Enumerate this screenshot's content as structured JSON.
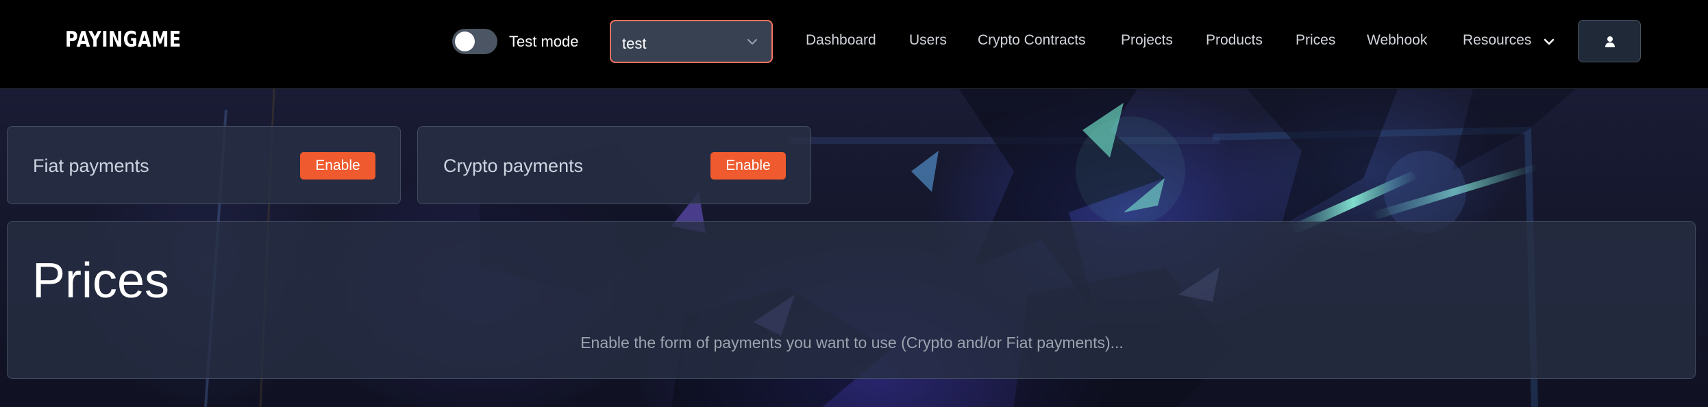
{
  "brand": {
    "logo_text": "PAYINGAME"
  },
  "header": {
    "test_mode": {
      "label": "Test mode",
      "enabled": false
    },
    "project_select": {
      "value": "test"
    },
    "nav": {
      "dashboard": "Dashboard",
      "users": "Users",
      "crypto_contracts": "Crypto Contracts",
      "projects": "Projects",
      "products": "Products",
      "prices": "Prices",
      "webhook": "Webhook",
      "resources": "Resources"
    },
    "icons": {
      "select_chevron": "chevron-down-icon",
      "resources_chevron": "chevron-down-icon",
      "user": "user-icon"
    }
  },
  "payments": {
    "fiat": {
      "title": "Fiat payments",
      "button": "Enable"
    },
    "crypto": {
      "title": "Crypto payments",
      "button": "Enable"
    }
  },
  "main": {
    "title": "Prices",
    "message": "Enable the form of payments you want to use (Crypto and/or Fiat payments)..."
  },
  "colors": {
    "accent": "#ef5a2e",
    "select_border": "#f97360",
    "navbar_bg": "#000000",
    "card_bg": "#283044"
  }
}
